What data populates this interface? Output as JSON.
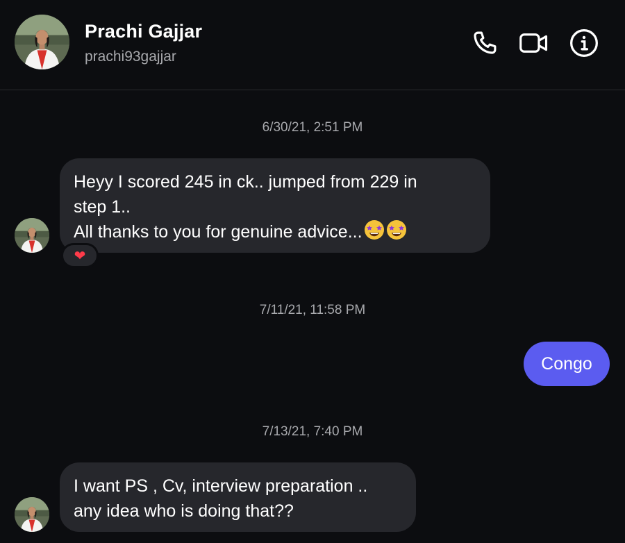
{
  "header": {
    "name": "Prachi Gajjar",
    "handle": "prachi93gajjar",
    "actions": [
      "phone-icon",
      "video-icon",
      "info-icon"
    ]
  },
  "messages": [
    {
      "timestamp": "6/30/21, 2:51 PM",
      "direction": "incoming",
      "lines": [
        "Heyy I scored 245 in ck.. jumped from 229 in",
        "step 1..",
        "All thanks to you for genuine advice..."
      ],
      "emoji": [
        "star-struck-emoji",
        "star-struck-emoji"
      ],
      "reaction": "❤"
    },
    {
      "timestamp": "7/11/21, 11:58 PM",
      "direction": "outgoing",
      "text": "Congo"
    },
    {
      "timestamp": "7/13/21, 7:40 PM",
      "direction": "incoming",
      "lines": [
        "I want PS , Cv, interview preparation ..",
        "any idea who is doing that??"
      ]
    }
  ],
  "colors": {
    "background": "#0c0d10",
    "incoming_bubble": "#26272c",
    "outgoing_bubble": "#5b5cf0",
    "secondary_text": "#a8a9ad"
  }
}
